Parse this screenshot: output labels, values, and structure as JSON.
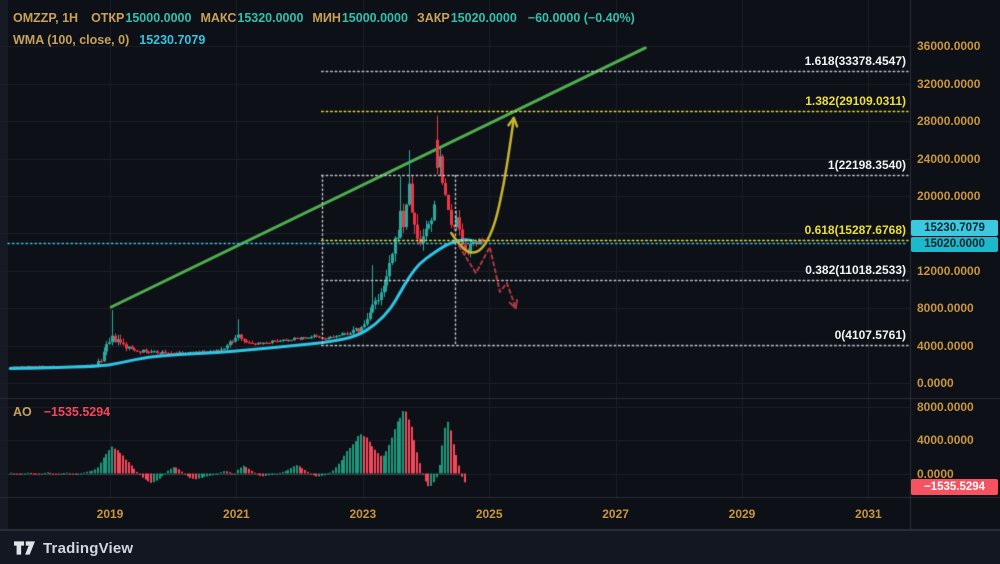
{
  "header": {
    "symbol": "OMZZP, 1H",
    "ohlc": [
      {
        "label": "ОТКР",
        "value": "15000.0000"
      },
      {
        "label": "МАКС",
        "value": "15320.0000"
      },
      {
        "label": "МИН",
        "value": "15000.0000"
      },
      {
        "label": "ЗАКР",
        "value": "15020.0000"
      }
    ],
    "change": "−60.0000 (−0.40%)",
    "wma_label": "WMA (100, close, 0)",
    "wma_value": "15230.7079"
  },
  "ao_pane": {
    "label": "AO",
    "value": "−1535.5294"
  },
  "axis_badges": {
    "wma": "15230.7079",
    "price": "15020.0000",
    "ao": "−1535.5294"
  },
  "footer": {
    "brand": "TradingView"
  },
  "colors": {
    "bg": "#0d1016",
    "footer_bg": "#131722",
    "grid": "#1a1f2a",
    "divider": "#2a2e39",
    "axis_text": "#c9963a",
    "legend_gold": "#c8a159",
    "legend_teal": "#31bfae",
    "wma_cyan": "#2fc6e6",
    "candle_up": "#27ab9e",
    "candle_down": "#f23645",
    "ao_up": "#189a7c",
    "ao_down": "#f4485a",
    "trend_green": "#4fb04f",
    "forecast_yellow": "#c8b62e",
    "forecast_red": "#b13a44",
    "fib_white": "#f2f3f5",
    "fib_yellow": "#ecdf35",
    "badge_cyan": "#1cb9ca",
    "badge_red": "#f7525f"
  },
  "chart_data": {
    "type": "candlestick",
    "symbol": "OMZZP",
    "interval": "1H",
    "legend_indicators": [
      "WMA (100, close, 0)",
      "AO"
    ],
    "x_axis": {
      "ticks": [
        2019,
        2021,
        2023,
        2025,
        2027,
        2029,
        2031
      ]
    },
    "price_axis": {
      "values": [
        36000,
        32000,
        28000,
        24000,
        20000,
        12000,
        8000,
        4000,
        0
      ],
      "labels": [
        "36000.0000",
        "32000.0000",
        "28000.0000",
        "24000.0000",
        "20000.0000",
        "12000.0000",
        "8000.0000",
        "4000.0000",
        "0.0000"
      ],
      "ylim": [
        -1600,
        41000
      ]
    },
    "ao_axis": {
      "values": [
        8000,
        4000,
        0
      ],
      "labels": [
        "8000.0000",
        "4000.0000",
        "0.0000"
      ],
      "ylim": [
        -4700,
        9000
      ]
    },
    "last_price": 15020.0,
    "wma_last": 15230.7079,
    "ao_last": -1535.5294,
    "fib": {
      "x_start_year": 2022.35,
      "x_end_year": 2024.46,
      "extend_to_year": 2031.6,
      "levels": [
        {
          "ratio": "1.618",
          "price": 33378.4547,
          "label": "1.618(33378.4547)",
          "color": "white"
        },
        {
          "ratio": "1.382",
          "price": 29109.0311,
          "label": "1.382(29109.0311)",
          "color": "yellow"
        },
        {
          "ratio": "1",
          "price": 22198.354,
          "label": "1(22198.3540)",
          "color": "white"
        },
        {
          "ratio": "0.618",
          "price": 15287.6768,
          "label": "0.618(15287.6768)",
          "color": "yellow"
        },
        {
          "ratio": "0.382",
          "price": 11018.2533,
          "label": "0.382(11018.2533)",
          "color": "white"
        },
        {
          "ratio": "0",
          "price": 4107.5761,
          "label": "0(4107.5761)",
          "color": "white"
        }
      ]
    },
    "trendline": {
      "start": {
        "year": 2019.02,
        "price": 8126
      },
      "end": {
        "year": 2027.47,
        "price": 35821
      }
    },
    "annotations": {
      "forecast_up_curve": [
        [
          2024.4,
          16040
        ],
        [
          2024.57,
          14330
        ],
        [
          2024.76,
          13795
        ],
        [
          2024.92,
          14543
        ],
        [
          2025.09,
          16895
        ],
        [
          2025.23,
          21172
        ],
        [
          2025.33,
          25449
        ],
        [
          2025.39,
          28336
        ]
      ],
      "forecast_down_zigzag": [
        [
          2024.52,
          14650
        ],
        [
          2024.79,
          11762
        ],
        [
          2025.01,
          14543
        ],
        [
          2025.17,
          9731
        ],
        [
          2025.28,
          10693
        ],
        [
          2025.42,
          8020
        ]
      ]
    },
    "price_path": [
      [
        2017.42,
        1750
      ],
      [
        2017.9,
        1800
      ],
      [
        2018.37,
        1750
      ],
      [
        2018.76,
        1900
      ],
      [
        2018.84,
        2600
      ],
      [
        2018.92,
        3800
      ],
      [
        2019.03,
        4800
      ],
      [
        2019.13,
        4300
      ],
      [
        2019.24,
        3800
      ],
      [
        2019.47,
        3400
      ],
      [
        2019.79,
        3250
      ],
      [
        2020.11,
        3150
      ],
      [
        2020.42,
        3300
      ],
      [
        2020.71,
        3400
      ],
      [
        2021.03,
        5100
      ],
      [
        2021.18,
        4200
      ],
      [
        2021.41,
        4300
      ],
      [
        2021.69,
        4600
      ],
      [
        2022.01,
        4800
      ],
      [
        2022.2,
        5000
      ],
      [
        2022.35,
        4700
      ],
      [
        2022.56,
        5000
      ],
      [
        2022.77,
        5400
      ],
      [
        2022.96,
        5800
      ],
      [
        2023.08,
        7200
      ],
      [
        2023.15,
        9200
      ],
      [
        2023.21,
        8300
      ],
      [
        2023.29,
        9800
      ],
      [
        2023.37,
        11500
      ],
      [
        2023.45,
        13800
      ],
      [
        2023.53,
        16000
      ],
      [
        2023.57,
        18200
      ],
      [
        2023.62,
        16800
      ],
      [
        2023.67,
        19500
      ],
      [
        2023.72,
        21000
      ],
      [
        2023.76,
        18200
      ],
      [
        2023.81,
        16200
      ],
      [
        2023.87,
        14800
      ],
      [
        2023.95,
        16200
      ],
      [
        2024.02,
        16800
      ],
      [
        2024.08,
        17800
      ],
      [
        2024.14,
        21500
      ],
      [
        2024.17,
        25500
      ],
      [
        2024.22,
        23000
      ],
      [
        2024.28,
        20500
      ],
      [
        2024.34,
        18200
      ],
      [
        2024.41,
        16800
      ],
      [
        2024.47,
        17500
      ],
      [
        2024.52,
        15800
      ],
      [
        2024.58,
        14200
      ],
      [
        2024.63,
        13400
      ],
      [
        2024.68,
        14600
      ],
      [
        2024.73,
        15400
      ],
      [
        2024.78,
        14900
      ],
      [
        2024.82,
        15200
      ],
      [
        2024.87,
        15020
      ]
    ],
    "range_profile": [
      [
        2017.42,
        150
      ],
      [
        2018.68,
        180
      ],
      [
        2018.84,
        900
      ],
      [
        2019.03,
        1500
      ],
      [
        2019.32,
        700
      ],
      [
        2020.4,
        350
      ],
      [
        2021.03,
        900
      ],
      [
        2021.3,
        400
      ],
      [
        2022.7,
        500
      ],
      [
        2023.1,
        1700
      ],
      [
        2023.55,
        2400
      ],
      [
        2024.17,
        2800
      ],
      [
        2024.5,
        1800
      ],
      [
        2024.87,
        700
      ]
    ],
    "spike_highs": [
      [
        2019.03,
        7800
      ],
      [
        2021.03,
        6800
      ],
      [
        2023.15,
        12600
      ],
      [
        2023.57,
        22100
      ],
      [
        2023.72,
        24900
      ],
      [
        2024.17,
        28600
      ],
      [
        2024.34,
        19800
      ]
    ],
    "wma_path": [
      [
        2017.42,
        1550
      ],
      [
        2018.8,
        1700
      ],
      [
        2019.2,
        2200
      ],
      [
        2019.6,
        2800
      ],
      [
        2020.1,
        3050
      ],
      [
        2020.7,
        3250
      ],
      [
        2021.3,
        3600
      ],
      [
        2021.9,
        4000
      ],
      [
        2022.5,
        4400
      ],
      [
        2022.9,
        5000
      ],
      [
        2023.2,
        6200
      ],
      [
        2023.45,
        8000
      ],
      [
        2023.6,
        9800
      ],
      [
        2023.75,
        11500
      ],
      [
        2023.9,
        12800
      ],
      [
        2024.1,
        13800
      ],
      [
        2024.3,
        14700
      ],
      [
        2024.45,
        15100
      ],
      [
        2024.55,
        15280
      ],
      [
        2024.65,
        15320
      ],
      [
        2024.72,
        15230
      ]
    ],
    "ao_path": [
      [
        2017.42,
        100
      ],
      [
        2017.56,
        -150
      ],
      [
        2017.7,
        130
      ],
      [
        2017.85,
        -120
      ],
      [
        2018.0,
        150
      ],
      [
        2018.15,
        -140
      ],
      [
        2018.3,
        110
      ],
      [
        2018.45,
        -160
      ],
      [
        2018.6,
        180
      ],
      [
        2018.72,
        350
      ],
      [
        2018.8,
        800
      ],
      [
        2018.88,
        1800
      ],
      [
        2018.96,
        2800
      ],
      [
        2019.02,
        3200
      ],
      [
        2019.1,
        2800
      ],
      [
        2019.18,
        2200
      ],
      [
        2019.26,
        1500
      ],
      [
        2019.34,
        800
      ],
      [
        2019.42,
        150
      ],
      [
        2019.5,
        -500
      ],
      [
        2019.58,
        -900
      ],
      [
        2019.65,
        -1150
      ],
      [
        2019.73,
        -850
      ],
      [
        2019.81,
        -350
      ],
      [
        2019.89,
        300
      ],
      [
        2019.97,
        700
      ],
      [
        2020.02,
        780
      ],
      [
        2020.1,
        400
      ],
      [
        2020.18,
        -200
      ],
      [
        2020.26,
        -560
      ],
      [
        2020.33,
        -700
      ],
      [
        2020.42,
        -550
      ],
      [
        2020.5,
        -380
      ],
      [
        2020.58,
        -250
      ],
      [
        2020.66,
        -120
      ],
      [
        2020.74,
        150
      ],
      [
        2020.8,
        330
      ],
      [
        2020.88,
        150
      ],
      [
        2020.95,
        -130
      ],
      [
        2021.02,
        550
      ],
      [
        2021.1,
        950
      ],
      [
        2021.18,
        600
      ],
      [
        2021.26,
        180
      ],
      [
        2021.34,
        -250
      ],
      [
        2021.42,
        -330
      ],
      [
        2021.5,
        -200
      ],
      [
        2021.6,
        -80
      ],
      [
        2021.7,
        150
      ],
      [
        2021.8,
        400
      ],
      [
        2021.88,
        820
      ],
      [
        2021.95,
        1020
      ],
      [
        2022.02,
        680
      ],
      [
        2022.1,
        280
      ],
      [
        2022.18,
        -140
      ],
      [
        2022.26,
        -370
      ],
      [
        2022.34,
        -290
      ],
      [
        2022.42,
        -140
      ],
      [
        2022.5,
        250
      ],
      [
        2022.58,
        900
      ],
      [
        2022.66,
        1800
      ],
      [
        2022.74,
        2700
      ],
      [
        2022.82,
        3400
      ],
      [
        2022.9,
        4300
      ],
      [
        2022.97,
        4850
      ],
      [
        2023.05,
        4250
      ],
      [
        2023.13,
        3400
      ],
      [
        2023.2,
        2500
      ],
      [
        2023.27,
        2050
      ],
      [
        2023.33,
        2300
      ],
      [
        2023.4,
        3300
      ],
      [
        2023.47,
        4800
      ],
      [
        2023.54,
        6300
      ],
      [
        2023.6,
        7300
      ],
      [
        2023.65,
        7650
      ],
      [
        2023.7,
        6900
      ],
      [
        2023.75,
        5600
      ],
      [
        2023.8,
        4100
      ],
      [
        2023.85,
        2400
      ],
      [
        2023.9,
        800
      ],
      [
        2023.95,
        -500
      ],
      [
        2024.0,
        -1400
      ],
      [
        2024.04,
        -1700
      ],
      [
        2024.09,
        -1350
      ],
      [
        2024.13,
        -800
      ],
      [
        2024.17,
        -200
      ],
      [
        2024.21,
        1600
      ],
      [
        2024.26,
        4300
      ],
      [
        2024.31,
        6600
      ],
      [
        2024.36,
        5700
      ],
      [
        2024.4,
        4200
      ],
      [
        2024.45,
        2700
      ],
      [
        2024.5,
        1200
      ],
      [
        2024.55,
        -350
      ],
      [
        2024.59,
        -950
      ],
      [
        2024.63,
        -1535
      ]
    ]
  }
}
